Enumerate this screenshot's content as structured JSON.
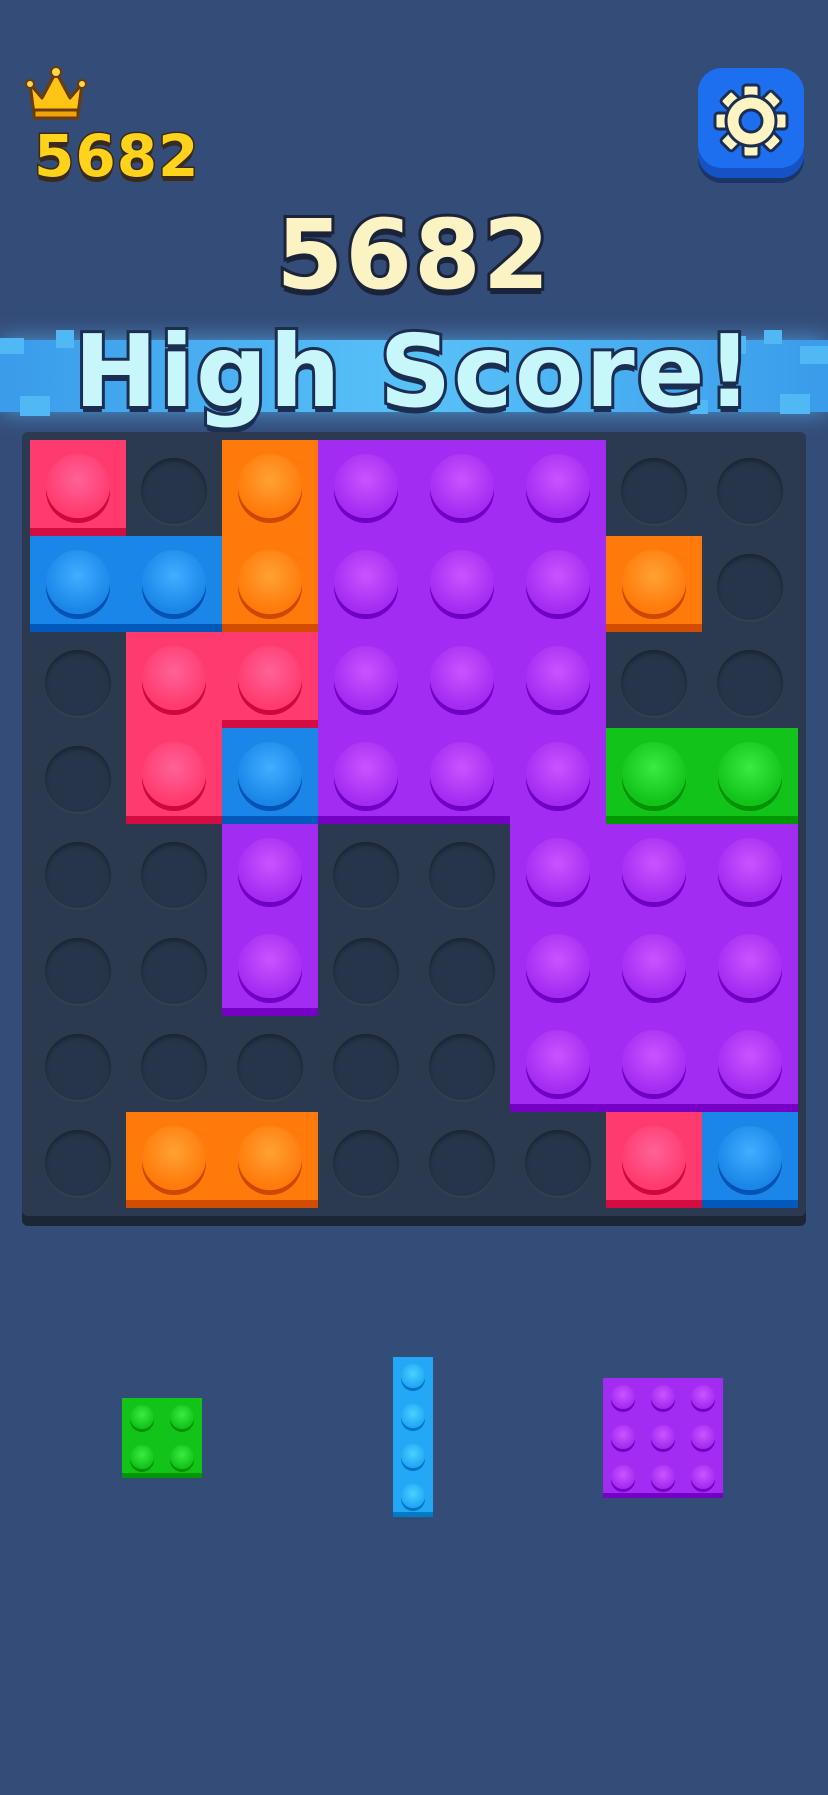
{
  "header": {
    "best_score": "5682",
    "score": "5682",
    "headline": "High Score!"
  },
  "icons": {
    "crown": "crown-icon",
    "settings": "gear-icon"
  },
  "colors": {
    "background": "#344c78",
    "pink": "#ff3a6e",
    "blue": "#1a86e8",
    "orange": "#ff7a0a",
    "purple": "#a32cf2",
    "green": "#12c41a",
    "cyan": "#22a8f5"
  },
  "board": {
    "rows": 8,
    "cols": 8,
    "grid": [
      [
        "pink",
        ".",
        "orange",
        "purple",
        "purple",
        "purple",
        ".",
        "."
      ],
      [
        "blue",
        "blue",
        "orange",
        "purple",
        "purple",
        "purple",
        "orange",
        "."
      ],
      [
        ".",
        "pink",
        "pink",
        "purple",
        "purple",
        "purple",
        ".",
        "."
      ],
      [
        ".",
        "pink",
        "blue",
        "purple",
        "purple",
        "purple",
        "green",
        "green"
      ],
      [
        ".",
        ".",
        "purple",
        ".",
        ".",
        "purple",
        "purple",
        "purple"
      ],
      [
        ".",
        ".",
        "purple",
        ".",
        ".",
        "purple",
        "purple",
        "purple"
      ],
      [
        ".",
        ".",
        ".",
        ".",
        ".",
        "purple",
        "purple",
        "purple"
      ],
      [
        ".",
        "orange",
        "orange",
        ".",
        ".",
        ".",
        "pink",
        "blue"
      ]
    ]
  },
  "tray": [
    {
      "name": "green-square-piece",
      "color": "green",
      "rows": 2,
      "cols": 2
    },
    {
      "name": "cyan-bar-piece",
      "color": "cyan",
      "rows": 4,
      "cols": 1
    },
    {
      "name": "purple-square-piece",
      "color": "purple",
      "rows": 3,
      "cols": 3
    }
  ]
}
